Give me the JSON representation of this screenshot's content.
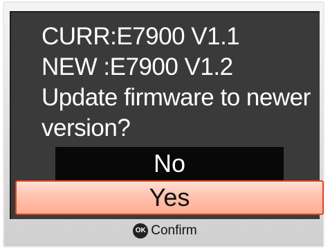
{
  "dialog": {
    "current_version_line": "CURR:E7900  V1.1",
    "new_version_line": "NEW  :E7900  V1.2",
    "question_line1": "Update firmware to newer",
    "question_line2": "version?"
  },
  "options": [
    {
      "label": "No",
      "selected": false
    },
    {
      "label": "Yes",
      "selected": true
    }
  ],
  "footer": {
    "ok_icon_text": "OK",
    "confirm_label": "Confirm"
  },
  "colors": {
    "screen_bg": "#3a3a3a",
    "highlight_border": "#e8431c",
    "highlight_fill": "#ffc2ae",
    "no_option_bg": "#080808"
  }
}
